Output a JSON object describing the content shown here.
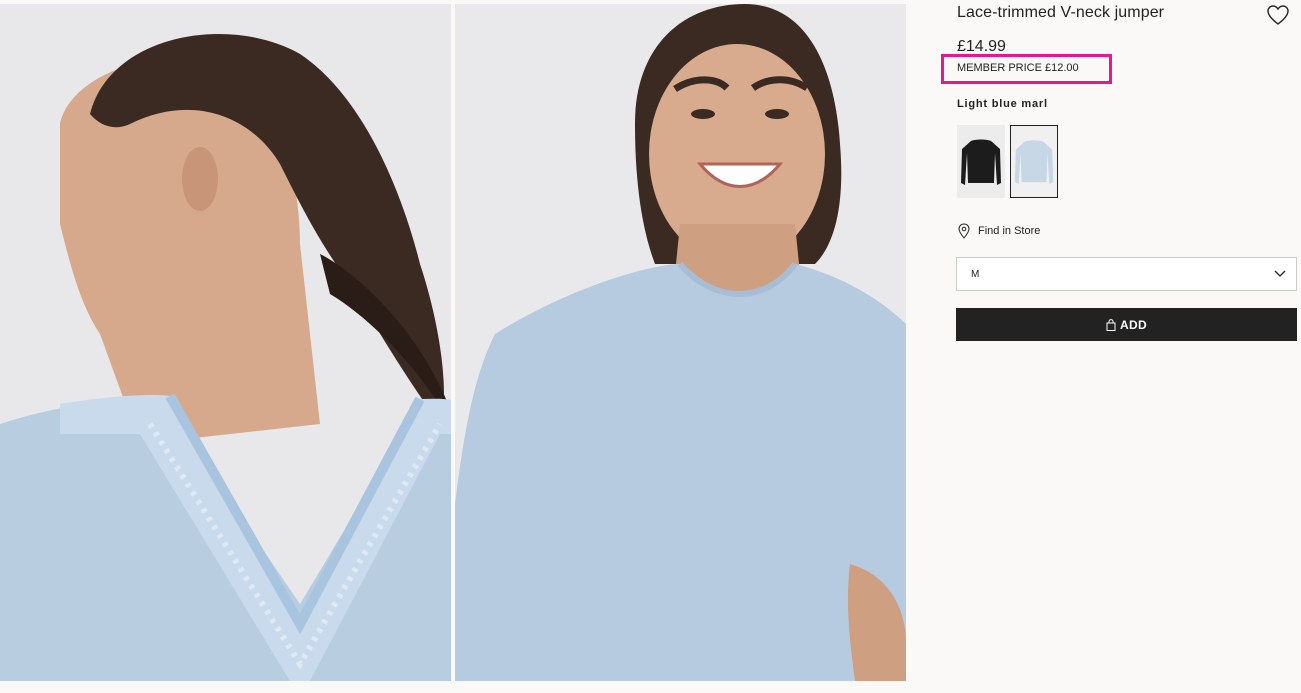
{
  "product": {
    "title": "Lace-trimmed V-neck jumper",
    "price": "£14.99",
    "member_price": "MEMBER PRICE £12.00",
    "color_name": "Light blue marl",
    "highlight_color": "#e8188c"
  },
  "swatches": [
    {
      "name": "Black",
      "color": "#1c1c1c",
      "selected": false
    },
    {
      "name": "Light blue marl",
      "color": "#c7d7e6",
      "selected": true
    }
  ],
  "actions": {
    "find_in_store": "Find in Store",
    "size_value": "M",
    "add_label": "ADD"
  },
  "icons": {
    "wishlist": "heart-outline-icon",
    "store": "map-pin-icon",
    "dropdown": "chevron-down-icon",
    "bag": "shopping-bag-icon"
  }
}
